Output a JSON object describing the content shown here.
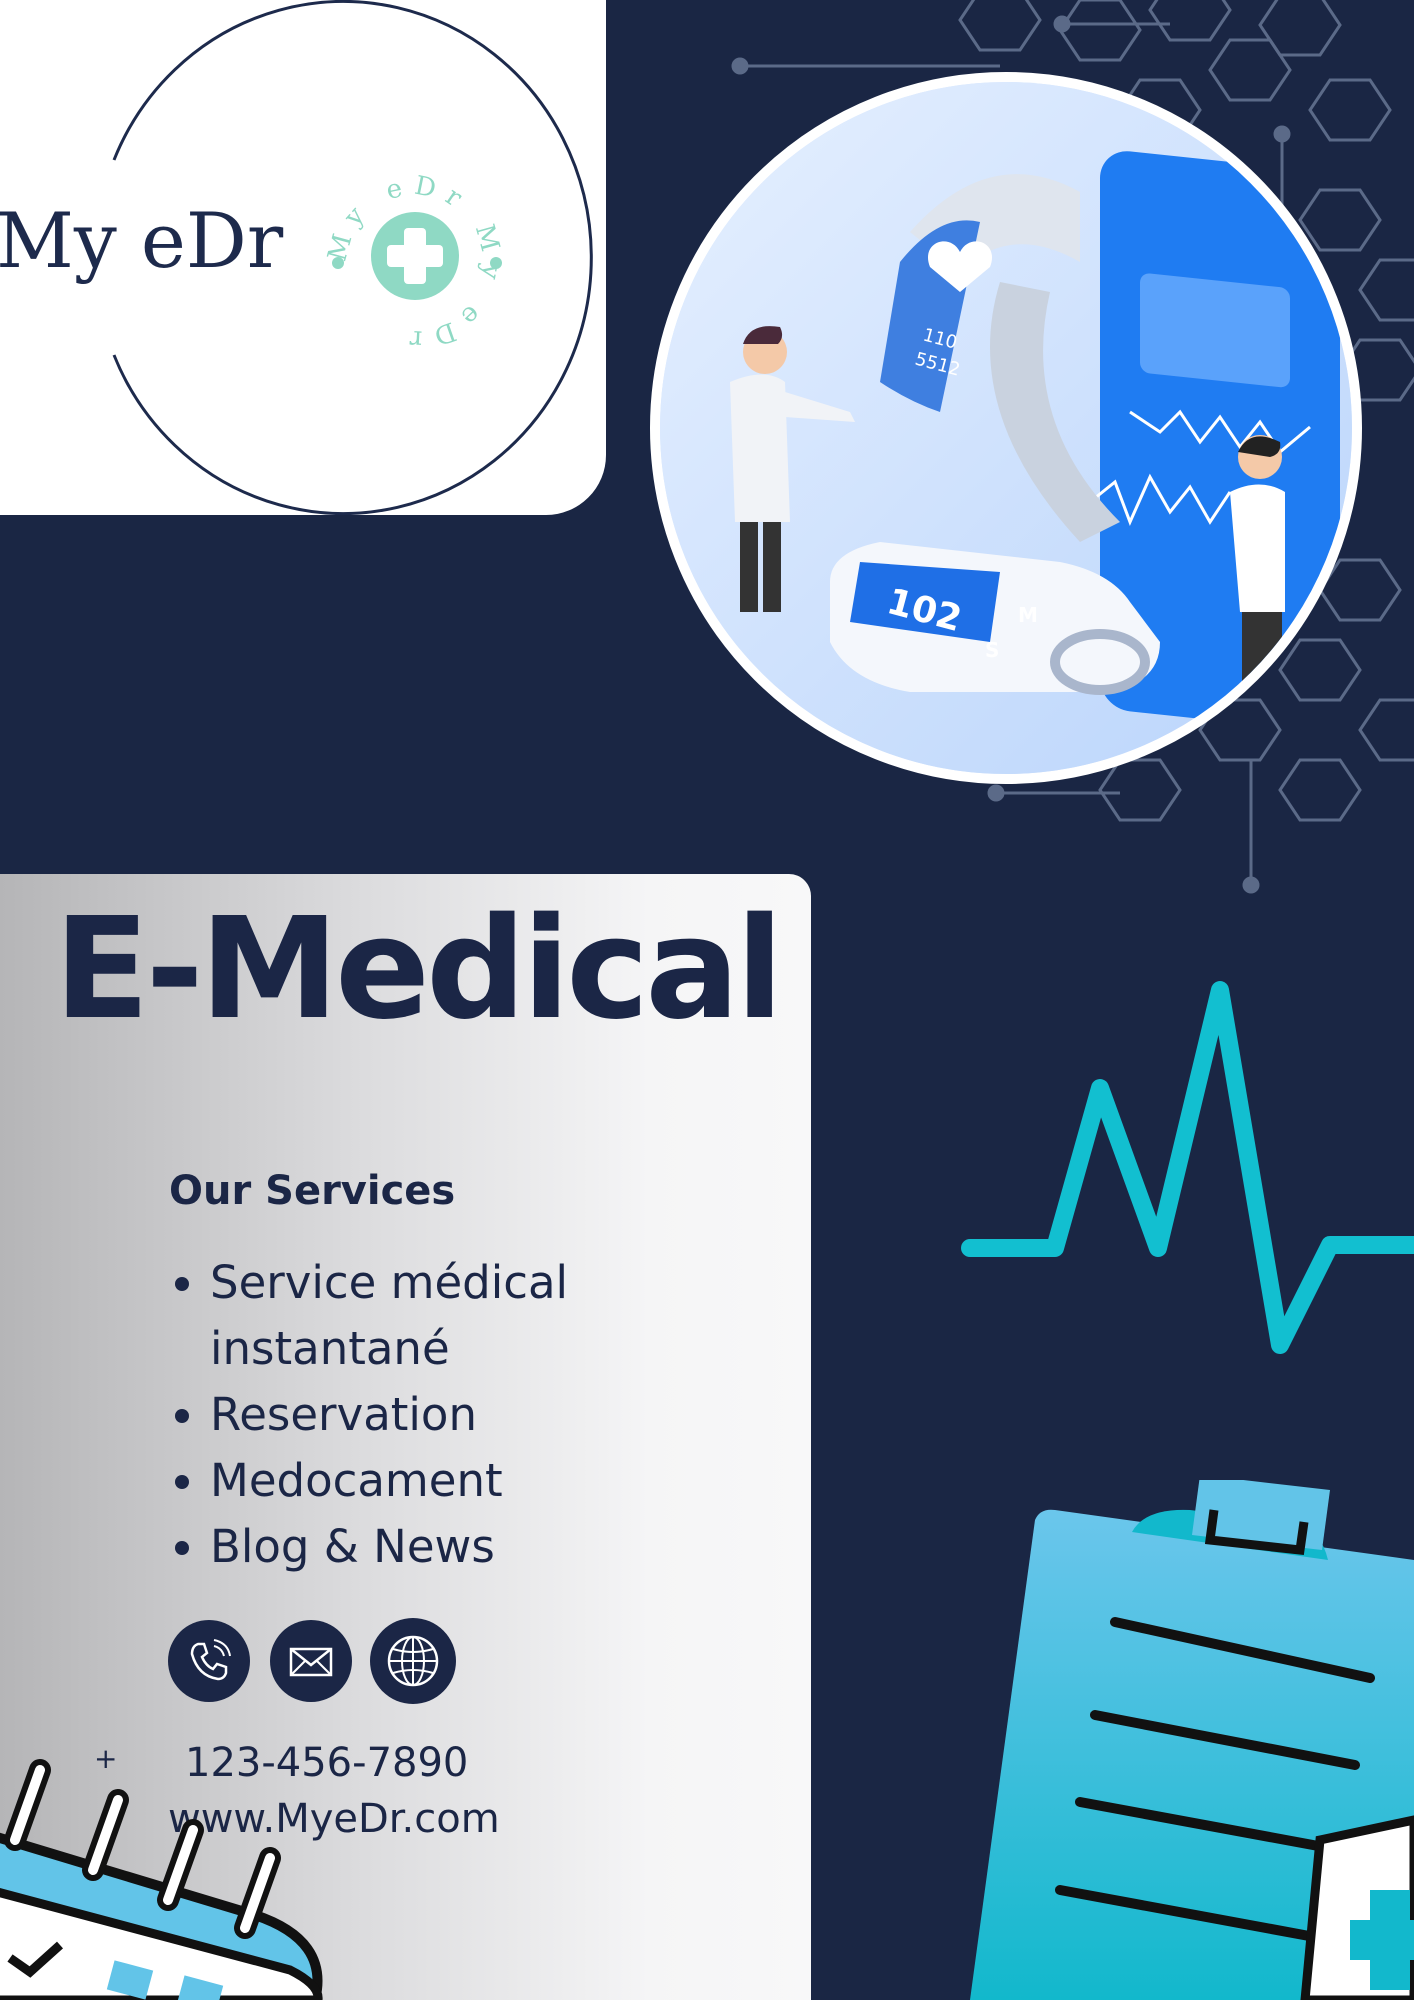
{
  "brand": {
    "name": "My eDr",
    "seal_text": "My eDr My eDr",
    "accent_color": "#8fd9c4"
  },
  "hero": {
    "image": "doctor-and-patient-with-health-devices-illustration",
    "display_readings": {
      "bp_value": "102",
      "heart_rate": "110",
      "steps": "5512",
      "monitor_buttons": [
        "M",
        "S"
      ]
    }
  },
  "headline": "E-Medical",
  "services": {
    "title": "Our Services",
    "items": [
      "Service médical instantané",
      "Reservation",
      "Medocament",
      "Blog & News"
    ]
  },
  "contact": {
    "icons": [
      "phone-icon",
      "mail-icon",
      "globe-icon"
    ],
    "plus": "+",
    "phone": "123-456-7890",
    "website": "www.MyeDr.com"
  },
  "colors": {
    "background": "#1a2644",
    "headline": "#1b2646",
    "pulse": "#12bfd0",
    "clipboard": "#62c4e8"
  }
}
